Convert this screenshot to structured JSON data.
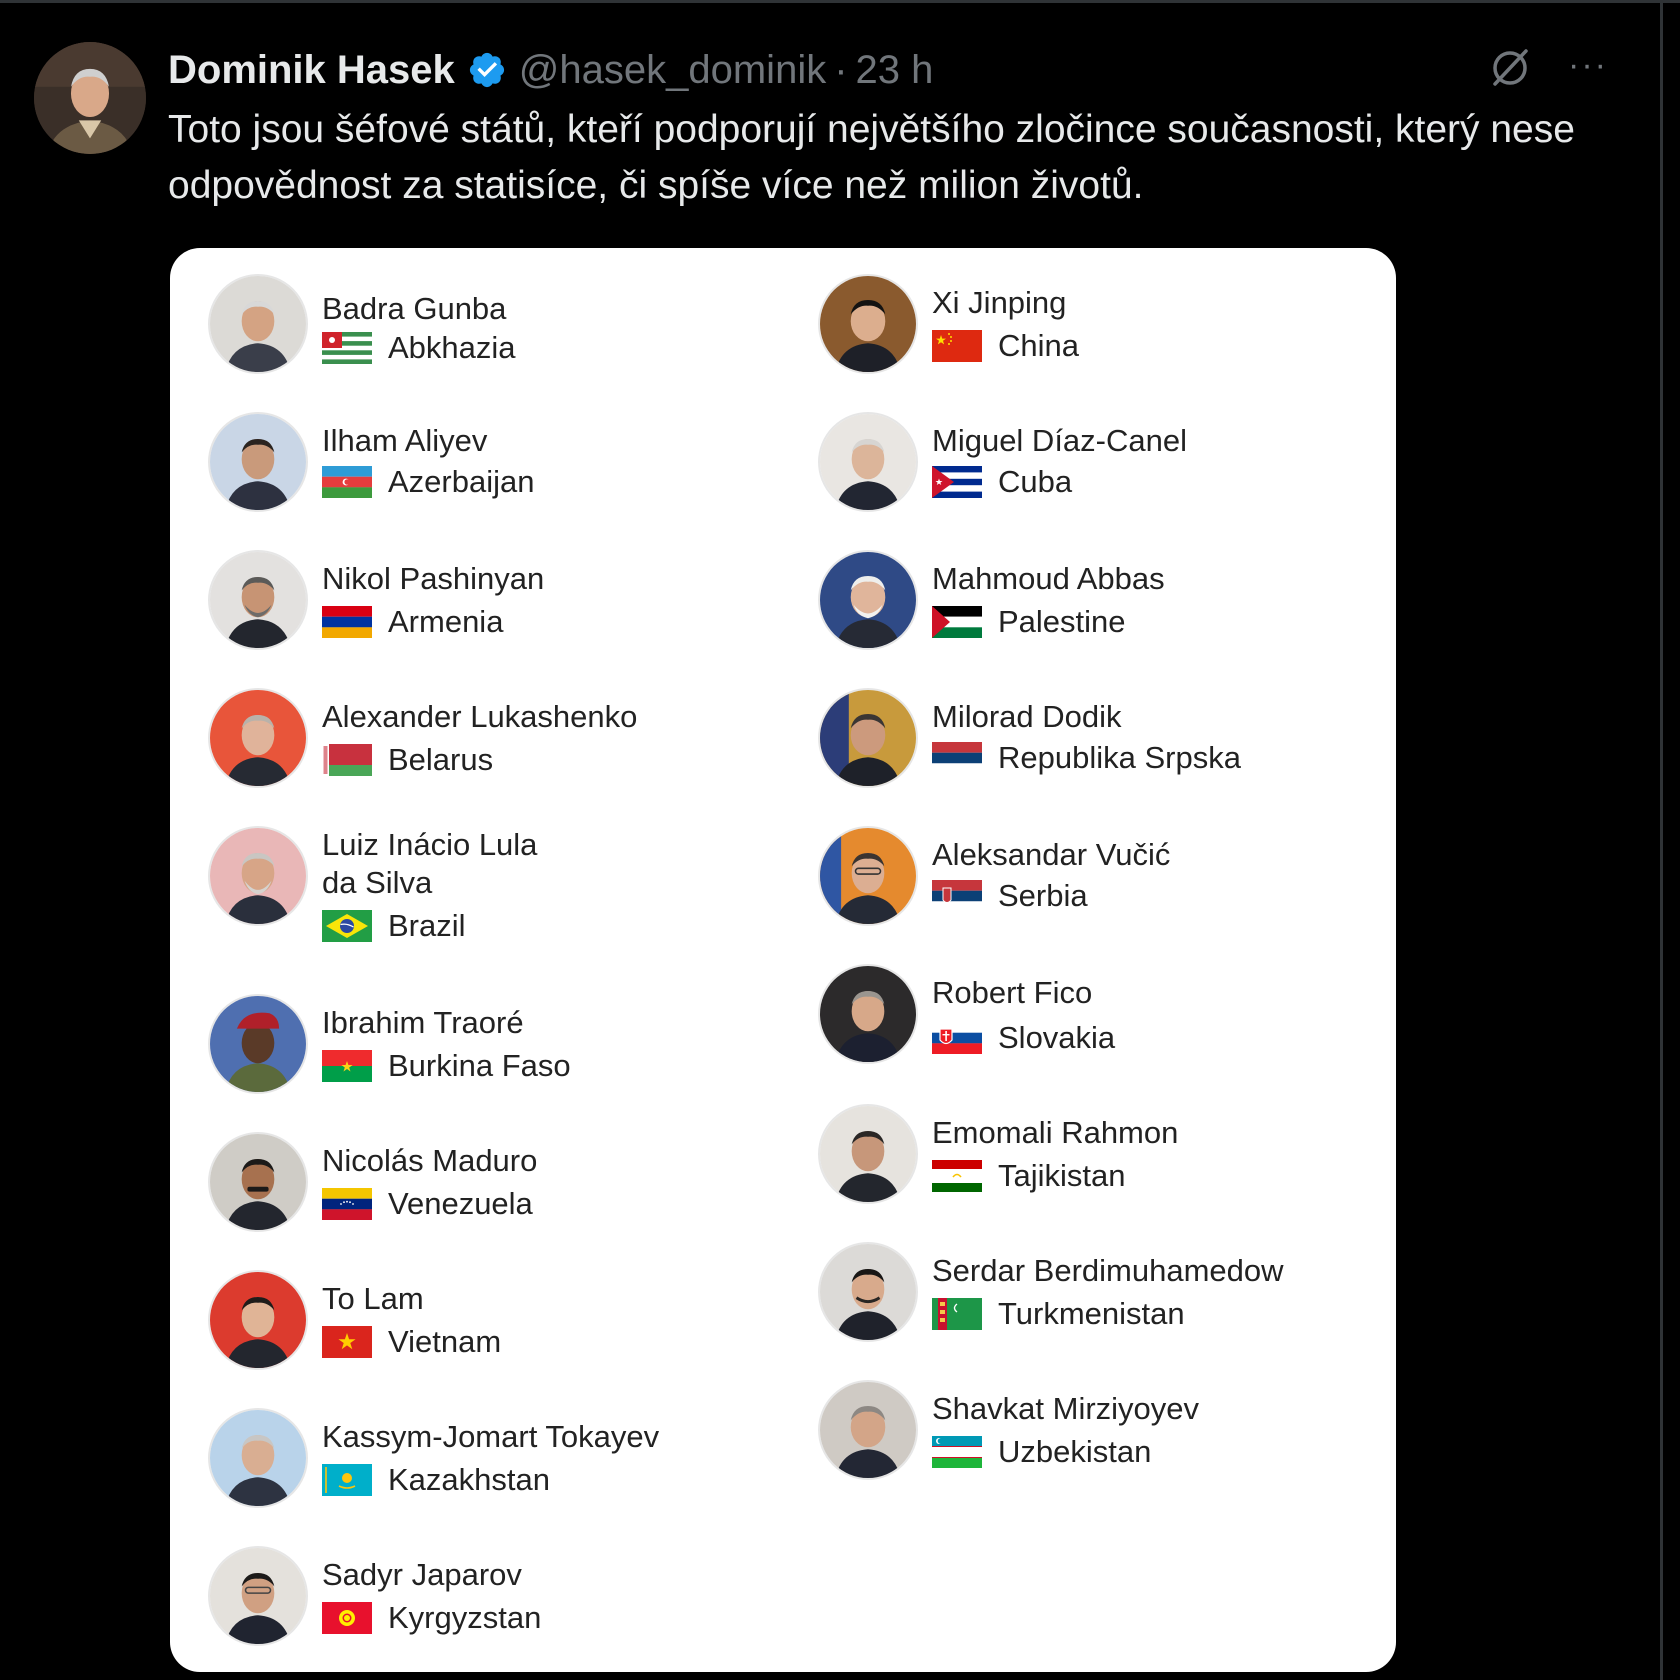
{
  "tweet": {
    "author": "Dominik Hasek",
    "handle": "@hasek_dominik",
    "separator": "·",
    "time": "23 h",
    "text": "Toto jsou šéfové států, kteří podporují největšího zločince současnosti, který nese odpovědnost za statisíce, či spíše více než milion životů.",
    "icons": {
      "verified": "verified-badge-icon",
      "grok": "grok-icon",
      "more": "more-icon"
    },
    "more_glyph": "···",
    "colors": {
      "background": "#000000",
      "text": "#e7e9ea",
      "muted": "#71767b",
      "verified": "#1d9bf0"
    }
  },
  "image_card": {
    "background": "#ffffff",
    "left_column": [
      {
        "name": "Badra Gunba",
        "country": "Abkhazia",
        "flag": "abkhazia-flag-icon"
      },
      {
        "name": "Ilham Aliyev",
        "country": "Azerbaijan",
        "flag": "azerbaijan-flag-icon"
      },
      {
        "name": "Nikol Pashinyan",
        "country": "Armenia",
        "flag": "armenia-flag-icon"
      },
      {
        "name": "Alexander Lukashenko",
        "country": "Belarus",
        "flag": "belarus-flag-icon"
      },
      {
        "name": "Luiz Inácio Lula",
        "name_line2": "da Silva",
        "country": "Brazil",
        "flag": "brazil-flag-icon"
      },
      {
        "name": "Ibrahim Traoré",
        "country": "Burkina Faso",
        "flag": "burkina-faso-flag-icon"
      },
      {
        "name": "Nicolás Maduro",
        "country": "Venezuela",
        "flag": "venezuela-flag-icon"
      },
      {
        "name": "To Lam",
        "country": "Vietnam",
        "flag": "vietnam-flag-icon"
      },
      {
        "name": "Kassym-Jomart Tokayev",
        "country": "Kazakhstan",
        "flag": "kazakhstan-flag-icon"
      },
      {
        "name": "Sadyr Japarov",
        "country": "Kyrgyzstan",
        "flag": "kyrgyzstan-flag-icon"
      }
    ],
    "right_column": [
      {
        "name": "Xi Jinping",
        "country": "China",
        "flag": "china-flag-icon"
      },
      {
        "name": "Miguel Díaz-Canel",
        "country": "Cuba",
        "flag": "cuba-flag-icon"
      },
      {
        "name": "Mahmoud Abbas",
        "country": "Palestine",
        "flag": "palestine-flag-icon"
      },
      {
        "name": "Milorad Dodik",
        "country": "Republika Srpska",
        "flag": "republika-srpska-flag-icon"
      },
      {
        "name": "Aleksandar Vučić",
        "country": "Serbia",
        "flag": "serbia-flag-icon"
      },
      {
        "name": "Robert Fico",
        "country": "Slovakia",
        "flag": "slovakia-flag-icon"
      },
      {
        "name": "Emomali Rahmon",
        "country": "Tajikistan",
        "flag": "tajikistan-flag-icon"
      },
      {
        "name": "Serdar Berdimuhamedow",
        "country": "Turkmenistan",
        "flag": "turkmenistan-flag-icon"
      },
      {
        "name": "Shavkat Mirziyoyev",
        "country": "Uzbekistan",
        "flag": "uzbekistan-flag-icon"
      }
    ]
  }
}
